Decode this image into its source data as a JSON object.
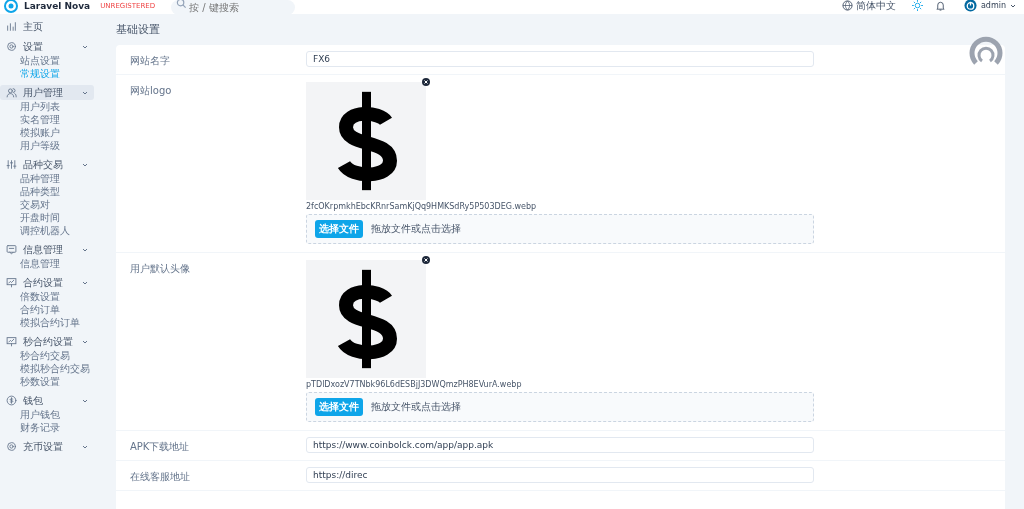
{
  "header": {
    "brand": "Laravel Nova",
    "badge": "UNREGISTERED",
    "search": {
      "placeholder": "按 / 键搜索"
    },
    "language": "简体中文",
    "user": "admin"
  },
  "sidebar": {
    "groups": [
      {
        "label": "主页",
        "selected": false
      },
      {
        "label": "设置",
        "selected": false,
        "expanded": true,
        "items": [
          {
            "label": "站点设置",
            "selected": false
          },
          {
            "label": "常规设置",
            "selected": true
          }
        ]
      },
      {
        "label": "用户管理",
        "selected": true,
        "expanded": true,
        "items": [
          {
            "label": "用户列表",
            "selected": false
          },
          {
            "label": "实名管理",
            "selected": false
          },
          {
            "label": "模拟账户",
            "selected": false
          },
          {
            "label": "用户等级",
            "selected": false
          }
        ]
      },
      {
        "label": "品种交易",
        "selected": false,
        "expanded": true,
        "items": [
          {
            "label": "品种管理",
            "selected": false
          },
          {
            "label": "品种类型",
            "selected": false
          },
          {
            "label": "交易对",
            "selected": false
          },
          {
            "label": "开盘时间",
            "selected": false
          },
          {
            "label": "调控机器人",
            "selected": false
          }
        ]
      },
      {
        "label": "信息管理",
        "selected": false,
        "expanded": true,
        "items": [
          {
            "label": "信息管理",
            "selected": false
          }
        ]
      },
      {
        "label": "合约设置",
        "selected": false,
        "expanded": true,
        "items": [
          {
            "label": "倍数设置",
            "selected": false
          },
          {
            "label": "合约订单",
            "selected": false
          },
          {
            "label": "模拟合约订单",
            "selected": false
          }
        ]
      },
      {
        "label": "秒合约设置",
        "selected": false,
        "expanded": true,
        "items": [
          {
            "label": "秒合约交易",
            "selected": false
          },
          {
            "label": "模拟秒合约交易",
            "selected": false
          },
          {
            "label": "秒数设置",
            "selected": false
          }
        ]
      },
      {
        "label": "钱包",
        "selected": false,
        "expanded": true,
        "items": [
          {
            "label": "用户钱包",
            "selected": false
          },
          {
            "label": "财务记录",
            "selected": false
          }
        ]
      },
      {
        "label": "充币设置",
        "selected": false,
        "expanded": true
      }
    ]
  },
  "page": {
    "title": "基础设置",
    "fields": [
      {
        "kind": "text",
        "label": "网站名字",
        "value": "FX6"
      },
      {
        "label": "网站logo",
        "filename": "2fcOKrpmkhEbcKRnrSamKjQq9HMKSdRy5P503DEG.webp",
        "button": "选择文件",
        "hint": "拖放文件或点击选择"
      },
      {
        "label": "用户默认头像",
        "filename": "pTDlDxozV7TNbk96L6dESBjJ3DWQmzPH8EVurA.webp",
        "button": "选择文件",
        "hint": "拖放文件或点击选择"
      },
      {
        "kind": "text",
        "label": "APK下载地址",
        "value": "https://www.coinbolck.com/app/app.apk"
      },
      {
        "kind": "text",
        "label": "在线客服地址",
        "value": "https://direc"
      }
    ]
  }
}
